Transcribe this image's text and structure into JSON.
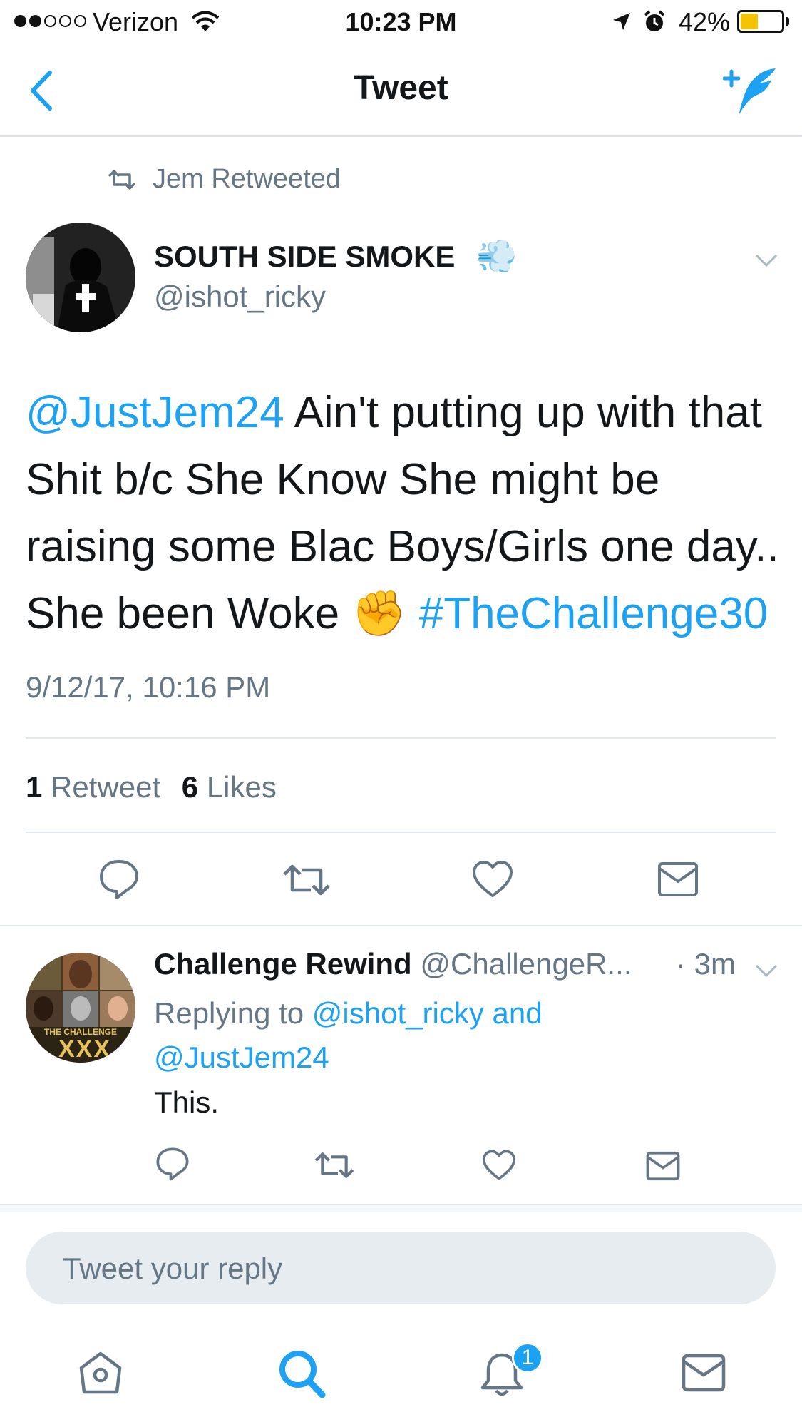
{
  "status_bar": {
    "carrier": "Verizon",
    "time": "10:23 PM",
    "battery": "42%",
    "battery_level": 0.42
  },
  "nav": {
    "title": "Tweet",
    "back_icon": "chevron-left-icon",
    "compose_icon": "compose-feather-icon"
  },
  "retweet_context": {
    "text": "Jem Retweeted"
  },
  "tweet": {
    "display_name": "SOUTH SIDE SMOKE",
    "name_emoji": "💨",
    "handle": "@ishot_ricky",
    "mention": "@JustJem24",
    "body_1": " Ain't putting up with that Shit b/c She Know She might be raising some Blac Boys/Girls one day.. She been Woke ",
    "emoji": "✊",
    "hashtag": "#TheChallenge30",
    "timestamp": "9/12/17, 10:16 PM",
    "retweet_count": "1",
    "retweet_label": "Retweet",
    "like_count": "6",
    "like_label": "Likes"
  },
  "reply": {
    "display_name": "Challenge Rewind",
    "handle": "@ChallengeR...",
    "time": "· 3m",
    "replying_prefix": "Replying to ",
    "replying_user1": "@ishot_ricky",
    "replying_and": " and",
    "replying_user2": "@JustJem24",
    "text": "This.",
    "avatar_caption": "THE CHALLENGE",
    "avatar_caption_2": "XXX"
  },
  "composer": {
    "placeholder": "Tweet your reply"
  },
  "tab_bar": {
    "notification_badge": "1"
  },
  "colors": {
    "accent": "#1da1f2",
    "secondary_text": "#657786",
    "divider": "#e1e8ed"
  }
}
